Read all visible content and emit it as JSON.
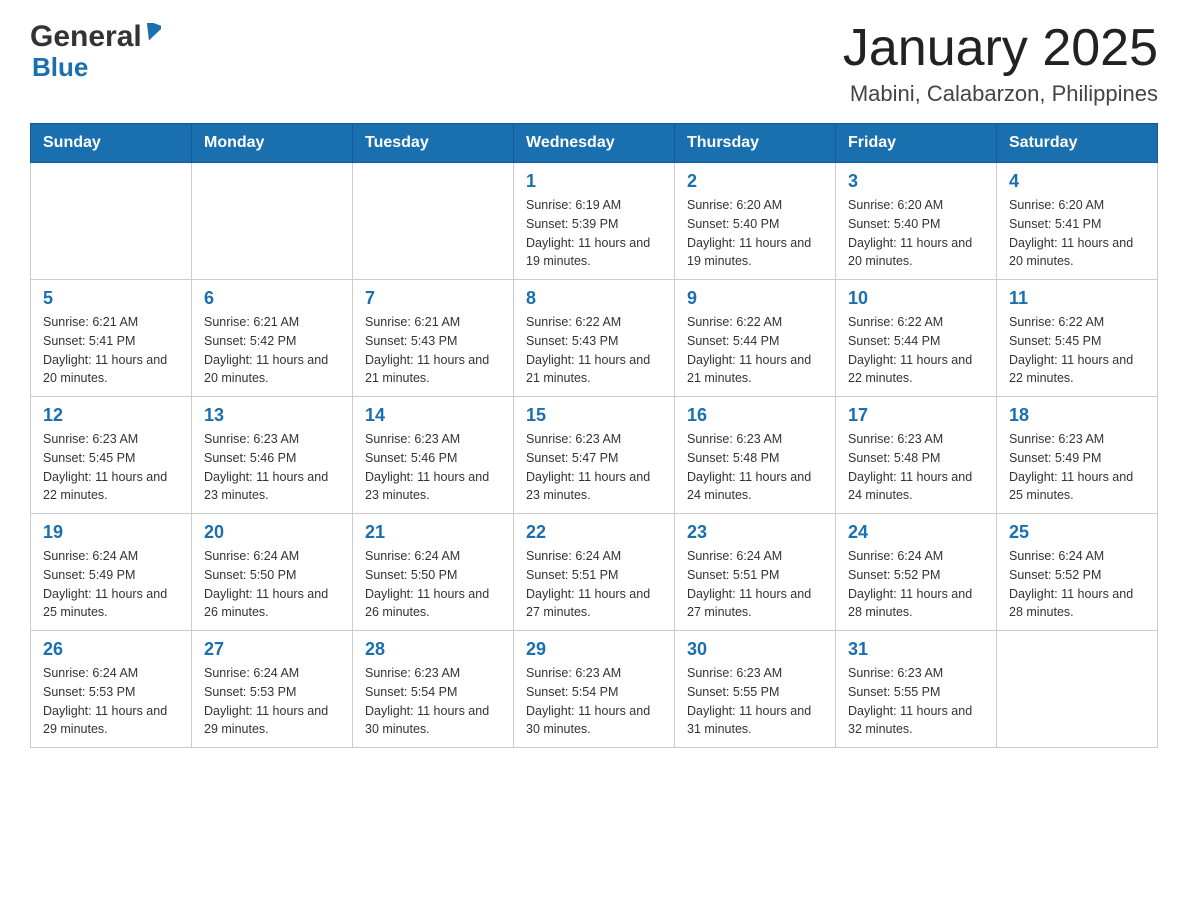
{
  "header": {
    "logo_general": "General",
    "logo_blue": "Blue",
    "month_title": "January 2025",
    "location": "Mabini, Calabarzon, Philippines"
  },
  "calendar": {
    "headers": [
      "Sunday",
      "Monday",
      "Tuesday",
      "Wednesday",
      "Thursday",
      "Friday",
      "Saturday"
    ],
    "weeks": [
      [
        {
          "day": "",
          "sunrise": "",
          "sunset": "",
          "daylight": ""
        },
        {
          "day": "",
          "sunrise": "",
          "sunset": "",
          "daylight": ""
        },
        {
          "day": "",
          "sunrise": "",
          "sunset": "",
          "daylight": ""
        },
        {
          "day": "1",
          "sunrise": "Sunrise: 6:19 AM",
          "sunset": "Sunset: 5:39 PM",
          "daylight": "Daylight: 11 hours and 19 minutes."
        },
        {
          "day": "2",
          "sunrise": "Sunrise: 6:20 AM",
          "sunset": "Sunset: 5:40 PM",
          "daylight": "Daylight: 11 hours and 19 minutes."
        },
        {
          "day": "3",
          "sunrise": "Sunrise: 6:20 AM",
          "sunset": "Sunset: 5:40 PM",
          "daylight": "Daylight: 11 hours and 20 minutes."
        },
        {
          "day": "4",
          "sunrise": "Sunrise: 6:20 AM",
          "sunset": "Sunset: 5:41 PM",
          "daylight": "Daylight: 11 hours and 20 minutes."
        }
      ],
      [
        {
          "day": "5",
          "sunrise": "Sunrise: 6:21 AM",
          "sunset": "Sunset: 5:41 PM",
          "daylight": "Daylight: 11 hours and 20 minutes."
        },
        {
          "day": "6",
          "sunrise": "Sunrise: 6:21 AM",
          "sunset": "Sunset: 5:42 PM",
          "daylight": "Daylight: 11 hours and 20 minutes."
        },
        {
          "day": "7",
          "sunrise": "Sunrise: 6:21 AM",
          "sunset": "Sunset: 5:43 PM",
          "daylight": "Daylight: 11 hours and 21 minutes."
        },
        {
          "day": "8",
          "sunrise": "Sunrise: 6:22 AM",
          "sunset": "Sunset: 5:43 PM",
          "daylight": "Daylight: 11 hours and 21 minutes."
        },
        {
          "day": "9",
          "sunrise": "Sunrise: 6:22 AM",
          "sunset": "Sunset: 5:44 PM",
          "daylight": "Daylight: 11 hours and 21 minutes."
        },
        {
          "day": "10",
          "sunrise": "Sunrise: 6:22 AM",
          "sunset": "Sunset: 5:44 PM",
          "daylight": "Daylight: 11 hours and 22 minutes."
        },
        {
          "day": "11",
          "sunrise": "Sunrise: 6:22 AM",
          "sunset": "Sunset: 5:45 PM",
          "daylight": "Daylight: 11 hours and 22 minutes."
        }
      ],
      [
        {
          "day": "12",
          "sunrise": "Sunrise: 6:23 AM",
          "sunset": "Sunset: 5:45 PM",
          "daylight": "Daylight: 11 hours and 22 minutes."
        },
        {
          "day": "13",
          "sunrise": "Sunrise: 6:23 AM",
          "sunset": "Sunset: 5:46 PM",
          "daylight": "Daylight: 11 hours and 23 minutes."
        },
        {
          "day": "14",
          "sunrise": "Sunrise: 6:23 AM",
          "sunset": "Sunset: 5:46 PM",
          "daylight": "Daylight: 11 hours and 23 minutes."
        },
        {
          "day": "15",
          "sunrise": "Sunrise: 6:23 AM",
          "sunset": "Sunset: 5:47 PM",
          "daylight": "Daylight: 11 hours and 23 minutes."
        },
        {
          "day": "16",
          "sunrise": "Sunrise: 6:23 AM",
          "sunset": "Sunset: 5:48 PM",
          "daylight": "Daylight: 11 hours and 24 minutes."
        },
        {
          "day": "17",
          "sunrise": "Sunrise: 6:23 AM",
          "sunset": "Sunset: 5:48 PM",
          "daylight": "Daylight: 11 hours and 24 minutes."
        },
        {
          "day": "18",
          "sunrise": "Sunrise: 6:23 AM",
          "sunset": "Sunset: 5:49 PM",
          "daylight": "Daylight: 11 hours and 25 minutes."
        }
      ],
      [
        {
          "day": "19",
          "sunrise": "Sunrise: 6:24 AM",
          "sunset": "Sunset: 5:49 PM",
          "daylight": "Daylight: 11 hours and 25 minutes."
        },
        {
          "day": "20",
          "sunrise": "Sunrise: 6:24 AM",
          "sunset": "Sunset: 5:50 PM",
          "daylight": "Daylight: 11 hours and 26 minutes."
        },
        {
          "day": "21",
          "sunrise": "Sunrise: 6:24 AM",
          "sunset": "Sunset: 5:50 PM",
          "daylight": "Daylight: 11 hours and 26 minutes."
        },
        {
          "day": "22",
          "sunrise": "Sunrise: 6:24 AM",
          "sunset": "Sunset: 5:51 PM",
          "daylight": "Daylight: 11 hours and 27 minutes."
        },
        {
          "day": "23",
          "sunrise": "Sunrise: 6:24 AM",
          "sunset": "Sunset: 5:51 PM",
          "daylight": "Daylight: 11 hours and 27 minutes."
        },
        {
          "day": "24",
          "sunrise": "Sunrise: 6:24 AM",
          "sunset": "Sunset: 5:52 PM",
          "daylight": "Daylight: 11 hours and 28 minutes."
        },
        {
          "day": "25",
          "sunrise": "Sunrise: 6:24 AM",
          "sunset": "Sunset: 5:52 PM",
          "daylight": "Daylight: 11 hours and 28 minutes."
        }
      ],
      [
        {
          "day": "26",
          "sunrise": "Sunrise: 6:24 AM",
          "sunset": "Sunset: 5:53 PM",
          "daylight": "Daylight: 11 hours and 29 minutes."
        },
        {
          "day": "27",
          "sunrise": "Sunrise: 6:24 AM",
          "sunset": "Sunset: 5:53 PM",
          "daylight": "Daylight: 11 hours and 29 minutes."
        },
        {
          "day": "28",
          "sunrise": "Sunrise: 6:23 AM",
          "sunset": "Sunset: 5:54 PM",
          "daylight": "Daylight: 11 hours and 30 minutes."
        },
        {
          "day": "29",
          "sunrise": "Sunrise: 6:23 AM",
          "sunset": "Sunset: 5:54 PM",
          "daylight": "Daylight: 11 hours and 30 minutes."
        },
        {
          "day": "30",
          "sunrise": "Sunrise: 6:23 AM",
          "sunset": "Sunset: 5:55 PM",
          "daylight": "Daylight: 11 hours and 31 minutes."
        },
        {
          "day": "31",
          "sunrise": "Sunrise: 6:23 AM",
          "sunset": "Sunset: 5:55 PM",
          "daylight": "Daylight: 11 hours and 32 minutes."
        },
        {
          "day": "",
          "sunrise": "",
          "sunset": "",
          "daylight": ""
        }
      ]
    ]
  }
}
